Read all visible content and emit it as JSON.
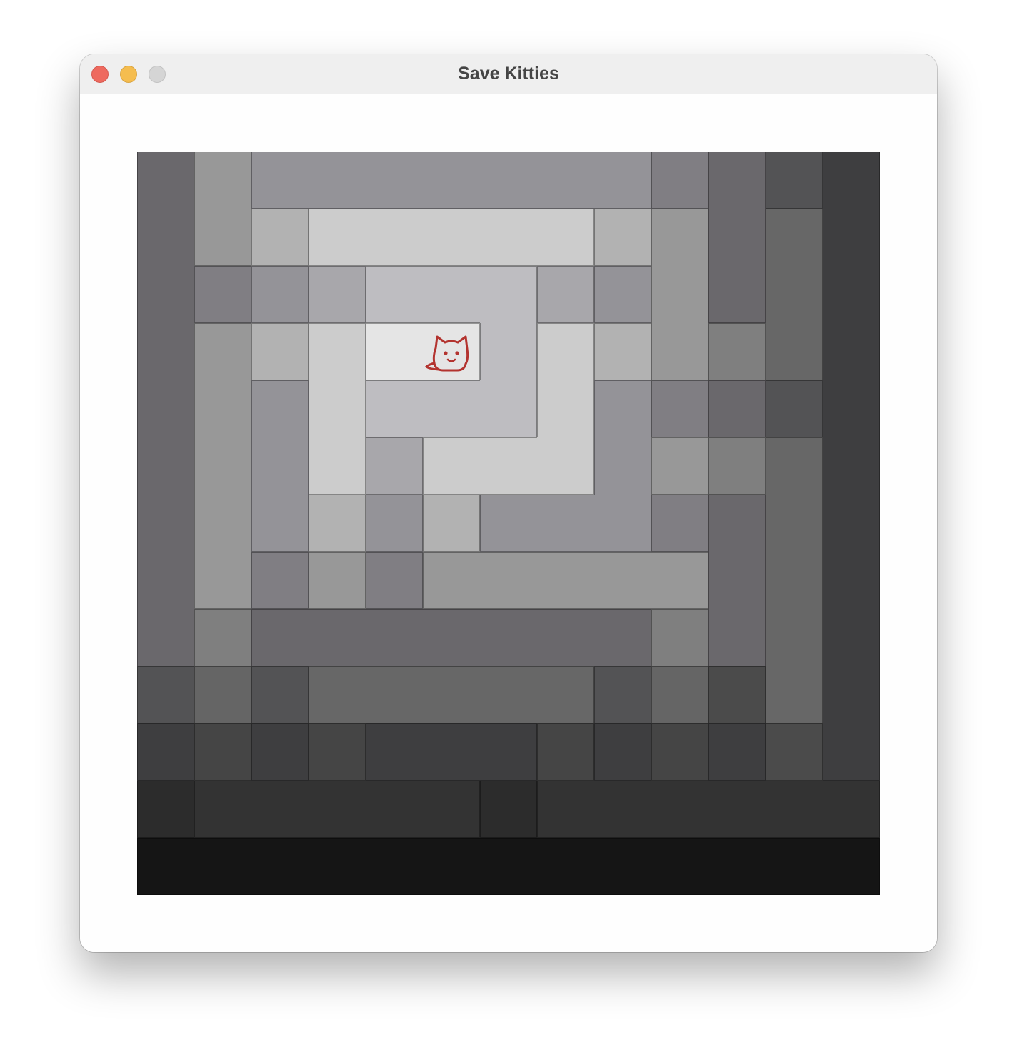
{
  "window": {
    "title": "Save Kitties",
    "controls": [
      "close",
      "minimize",
      "zoom"
    ]
  },
  "game": {
    "grid_size": 13,
    "palette": {
      "a": "#6a686c",
      "b": "#989898",
      "c": "#949398",
      "d": "#807e83",
      "e": "#535355",
      "f": "#3e3e40",
      "g": "#b2b2b2",
      "h": "#cccccc",
      "i": "#676767",
      "j": "#a8a7ab",
      "k": "#bebdc1",
      "l": "#e5e5e5",
      "m": "#7f7f7f",
      "n": "#656565",
      "o": "#4b4b4b",
      "p": "#454545",
      "q": "#2c2c2c",
      "r": "#333333",
      "s": "#151515"
    },
    "rows": [
      "abcccccccdaef",
      "abghhhhhgbaif",
      "adcjkkkjcbaif",
      "abghlLkhgbmif",
      "abchkkkhcdaef",
      "abchjhhhcbmif",
      "abcgcgcccdaif",
      "abdbdbbbbbaif",
      "amaaaaaaamaif",
      "eneiiiiienoif",
      "fpfpfffpfpfof",
      "qrrrrrqrrrrrr",
      "sssssssssssss"
    ],
    "kitty": {
      "row": 3,
      "col": 5,
      "icon": "cat-face-icon",
      "color": "#b3332f"
    }
  }
}
